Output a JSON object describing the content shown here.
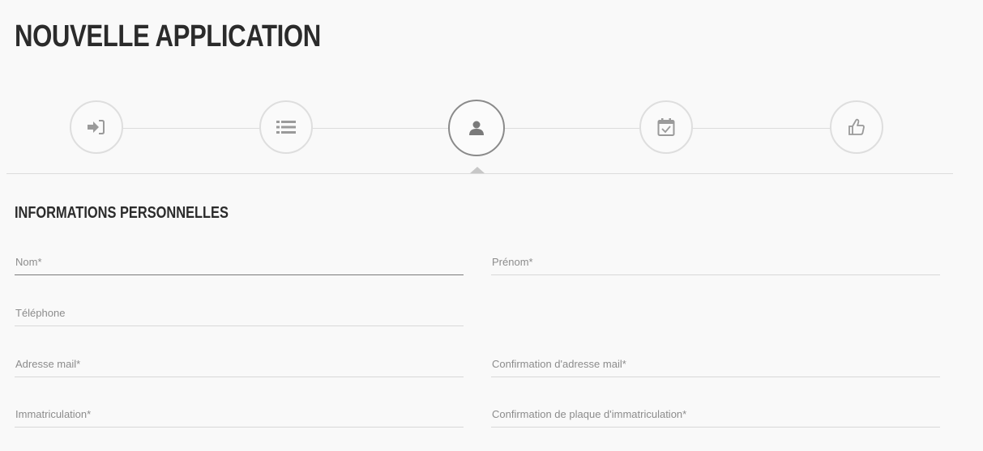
{
  "page": {
    "title": "NOUVELLE APPLICATION"
  },
  "stepper": {
    "steps": [
      {
        "icon": "sign-in-icon",
        "state": "inactive"
      },
      {
        "icon": "list-icon",
        "state": "inactive"
      },
      {
        "icon": "user-icon",
        "state": "active"
      },
      {
        "icon": "calendar-check-icon",
        "state": "inactive"
      },
      {
        "icon": "thumbs-up-icon",
        "state": "inactive"
      }
    ]
  },
  "section": {
    "title": "INFORMATIONS PERSONNELLES"
  },
  "form": {
    "nom": {
      "placeholder": "Nom*",
      "value": ""
    },
    "prenom": {
      "placeholder": "Prénom*",
      "value": ""
    },
    "telephone": {
      "placeholder": "Téléphone",
      "value": ""
    },
    "email": {
      "placeholder": "Adresse mail*",
      "value": ""
    },
    "email_confirm": {
      "placeholder": "Confirmation d'adresse mail*",
      "value": ""
    },
    "immatriculation": {
      "placeholder": "Immatriculation*",
      "value": ""
    },
    "immatriculation_confirm": {
      "placeholder": "Confirmation de plaque d'immatriculation*",
      "value": ""
    }
  },
  "colors": {
    "background": "#f9f9f9",
    "text": "#2b2b2b",
    "border": "#dcdcdc",
    "icon": "#9a9a9a",
    "active_icon": "#7a7a7a"
  }
}
